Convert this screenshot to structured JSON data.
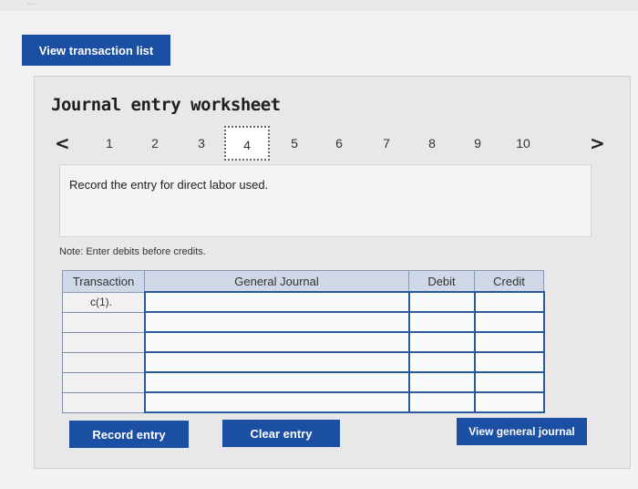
{
  "header": {
    "cut_text": "...",
    "view_transaction_list_label": "View transaction list"
  },
  "worksheet": {
    "title": "Journal entry worksheet",
    "nav": {
      "prev_icon": "chevron-left-icon",
      "next_icon": "chevron-right-icon",
      "steps": [
        "1",
        "2",
        "3",
        "4",
        "5",
        "6",
        "7",
        "8",
        "9",
        "10"
      ],
      "active_step": "4"
    },
    "prompt": "Record the entry for direct labor used.",
    "note": "Note: Enter debits before credits.",
    "table": {
      "columns": [
        "Transaction",
        "General Journal",
        "Debit",
        "Credit"
      ],
      "rows": [
        {
          "transaction": "c(1).",
          "account": "",
          "debit": "",
          "credit": ""
        },
        {
          "transaction": "",
          "account": "",
          "debit": "",
          "credit": ""
        },
        {
          "transaction": "",
          "account": "",
          "debit": "",
          "credit": ""
        },
        {
          "transaction": "",
          "account": "",
          "debit": "",
          "credit": ""
        },
        {
          "transaction": "",
          "account": "",
          "debit": "",
          "credit": ""
        },
        {
          "transaction": "",
          "account": "",
          "debit": "",
          "credit": ""
        }
      ]
    },
    "buttons": {
      "record": "Record entry",
      "clear": "Clear entry",
      "view_general_journal": "View general journal"
    }
  },
  "colors": {
    "button_blue": "#1a4fa3",
    "header_blue": "#cfd8e6",
    "panel_gray": "#e8e8e8"
  }
}
